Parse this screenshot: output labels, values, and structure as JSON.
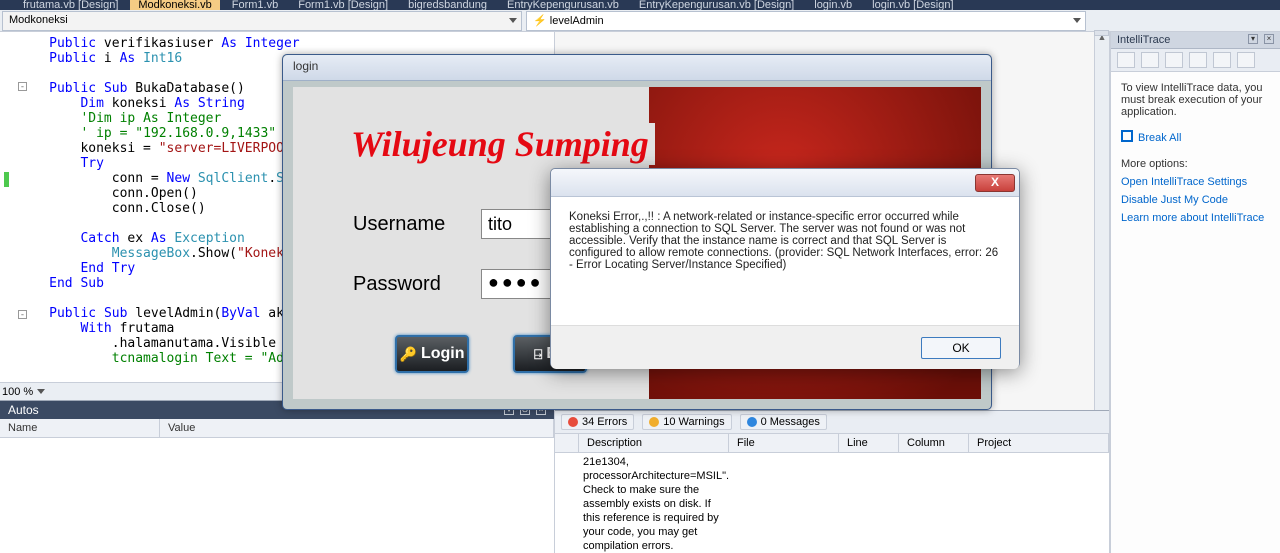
{
  "tabs": {
    "items": [
      "Modkoneksi.vb",
      "Form1.vb",
      "Form1.vb [Design]",
      "bigredsbandung",
      "EntryKepengurusan.vb",
      "EntryKepengurusan.vb [Design]",
      "login.vb",
      "login.vb [Design]"
    ],
    "active": 1,
    "peek": "frutama.vb [Design]"
  },
  "breadcrumb": {
    "left": "Modkoneksi",
    "right": "levelAdmin"
  },
  "code": {
    "text": "     Public verifikasiuser As Integer\n     Public i As Int16\n\n     Public Sub BukaDatabase()\n         Dim koneksi As String\n         'Dim ip As Integer\n         ' ip = \"192.168.0.9,1433\"\n         koneksi = \"server=LIVERPOOL-PC\n         Try\n             conn = New SqlClient.SqlCo\n             conn.Open()\n             conn.Close()\n\n         Catch ex As Exception\n             MessageBox.Show(\"Koneksi E\n         End Try\n     End Sub\n\n     Public Sub levelAdmin(ByVal aktif \n         With frutama\n             .halamanutama.Visible = ak\n             .tsnamalogin.Text = \"Admin"
  },
  "zoom": {
    "value": "100 %"
  },
  "autos": {
    "title": "Autos",
    "cols": {
      "name": "Name",
      "value": "Value"
    }
  },
  "errorlist": {
    "tabs": {
      "errors": "34 Errors",
      "warnings": "10 Warnings",
      "messages": "0 Messages"
    },
    "cols": {
      "desc": "Description",
      "file": "File",
      "line": "Line",
      "column": "Column",
      "project": "Project"
    },
    "row0": {
      "desc": "21e1304, processorArchitecture=MSIL\". Check to make sure the assembly exists on disk. If this reference is required by your code, you may get compilation errors."
    }
  },
  "login": {
    "title": "login",
    "welcome": "Wilujeung Sumping",
    "usernameLabel": "Username",
    "passwordLabel": "Password",
    "usernameValue": "tito",
    "passwordMasked": "●●●●",
    "loginBtn": "Login",
    "exitBtn": "Ex"
  },
  "msgbox": {
    "text": "Koneksi Error,.,!! : A network-related or instance-specific error occurred while establishing a connection to SQL Server. The server was not found or was not accessible. Verify that the instance name is correct and that SQL Server is configured to allow remote connections. (provider: SQL Network Interfaces, error: 26 - Error Locating Server/Instance Specified)",
    "ok": "OK",
    "close": "X"
  },
  "intellitrace": {
    "title": "IntelliTrace",
    "intro": "To view IntelliTrace data, you must break execution of your application.",
    "break": "Break All",
    "more": "More options:",
    "links": {
      "settings": "Open IntelliTrace Settings",
      "disableJmc": "Disable Just My Code",
      "learn": "Learn more about IntelliTrace"
    }
  }
}
